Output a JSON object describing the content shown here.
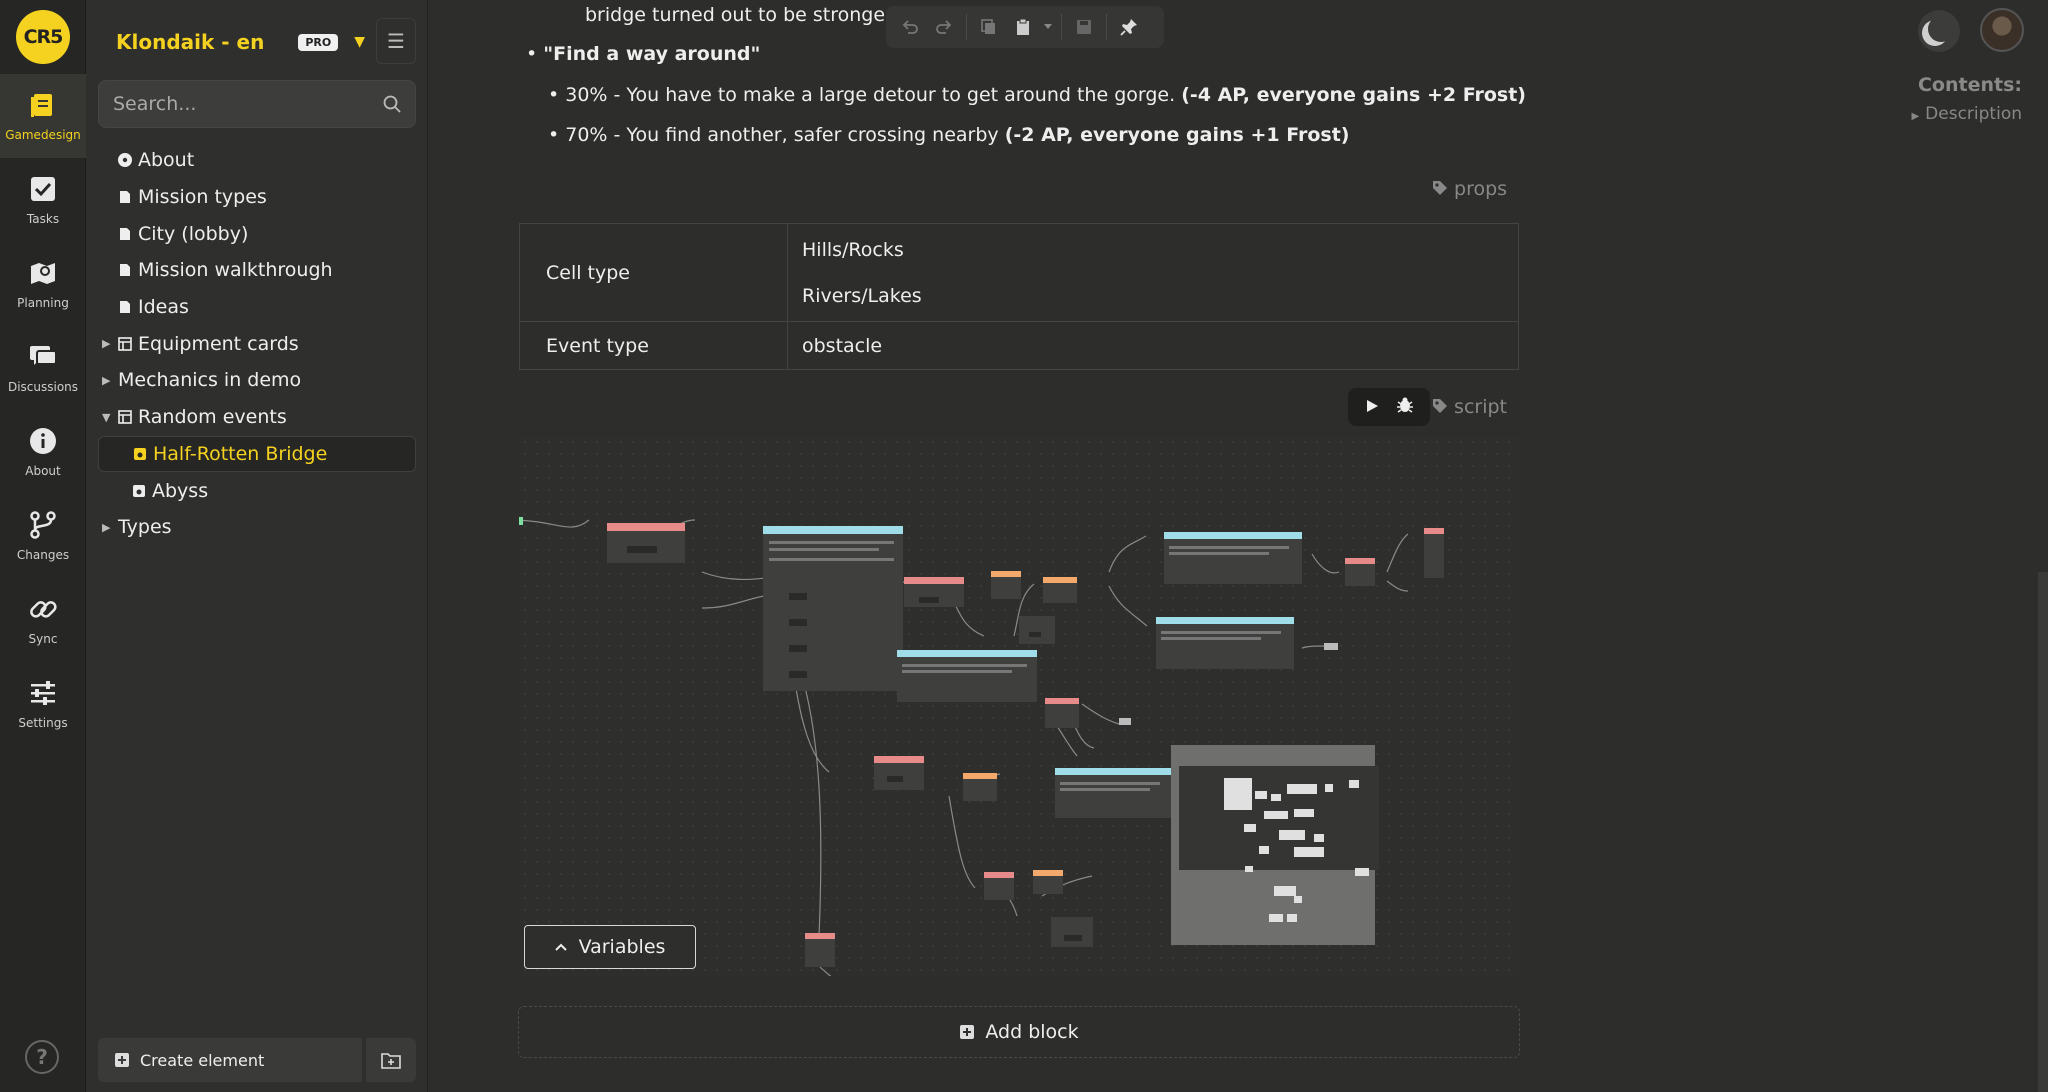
{
  "app": {
    "logo_text": "CR5",
    "accent": "#f4d21f"
  },
  "rail": {
    "items": [
      {
        "label": "Gamedesign",
        "icon": "document-stack-icon",
        "active": true
      },
      {
        "label": "Tasks",
        "icon": "checkbox-icon"
      },
      {
        "label": "Planning",
        "icon": "map-pin-icon"
      },
      {
        "label": "Discussions",
        "icon": "chat-bubbles-icon"
      },
      {
        "label": "About",
        "icon": "info-icon"
      },
      {
        "label": "Changes",
        "icon": "branch-icon"
      },
      {
        "label": "Sync",
        "icon": "link-icon"
      },
      {
        "label": "Settings",
        "icon": "sliders-icon"
      }
    ],
    "help_label": "?"
  },
  "sidebar": {
    "project_title": "Klondaik - en",
    "pro_badge": "PRO",
    "search_placeholder": "Search...",
    "tree": [
      {
        "label": "About",
        "level": 0,
        "icon": "info-dot-icon"
      },
      {
        "label": "Mission types",
        "level": 0,
        "icon": "doc-icon"
      },
      {
        "label": "City (lobby)",
        "level": 0,
        "icon": "doc-icon"
      },
      {
        "label": "Mission walkthrough",
        "level": 0,
        "icon": "doc-icon"
      },
      {
        "label": "Ideas",
        "level": 0,
        "icon": "doc-icon"
      },
      {
        "label": "Equipment cards",
        "level": 0,
        "icon": "table-icon",
        "caret": "right"
      },
      {
        "label": "Mechanics in demo",
        "level": 0,
        "caret": "right"
      },
      {
        "label": "Random events",
        "level": 0,
        "icon": "table-icon",
        "caret": "down"
      },
      {
        "label": "Half-Rotten Bridge",
        "level": 1,
        "icon": "script-doc-icon",
        "selected": true
      },
      {
        "label": "Abyss",
        "level": 1,
        "icon": "script-doc-icon"
      },
      {
        "label": "Types",
        "level": 0,
        "caret": "right"
      }
    ],
    "create_label": "Create element"
  },
  "document": {
    "line1": "bridge turned out to be stronger t",
    "option_title": "\"Find a way around\"",
    "outcome1_text": "30% - You have to make a large detour to get around the gorge. ",
    "outcome1_bold": "(-4 AP, everyone gains +2 Frost)",
    "outcome2_text": "70% - You find another, safer crossing nearby ",
    "outcome2_bold": "(-2 AP, everyone gains +1 Frost)",
    "props_label": "props",
    "props": {
      "cell_type_key": "Cell type",
      "cell_type_values": [
        "Hills/Rocks",
        "Rivers/Lakes"
      ],
      "event_type_key": "Event type",
      "event_type_value": "obstacle"
    },
    "script_label": "script",
    "variables_label": "Variables",
    "add_block_label": "Add block"
  },
  "contents": {
    "title": "Contents:",
    "items": [
      "Description"
    ]
  }
}
